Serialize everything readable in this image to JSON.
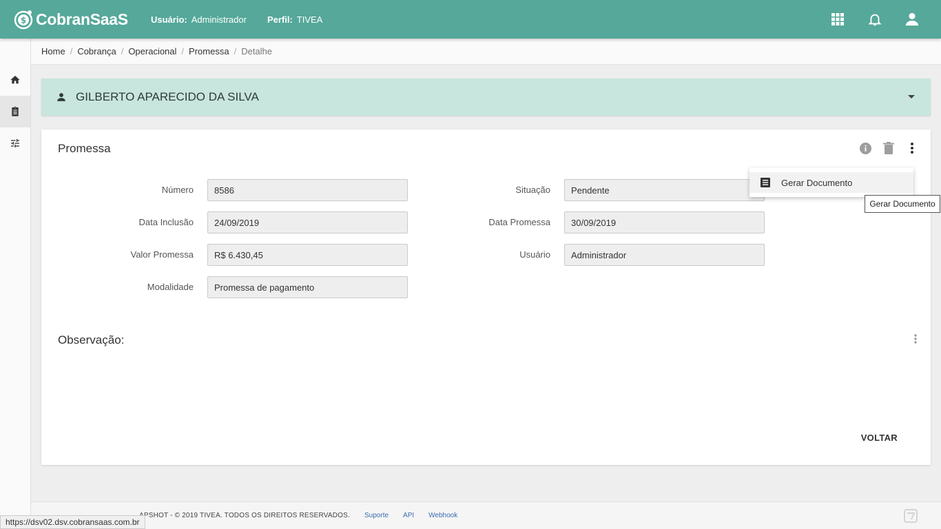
{
  "header": {
    "brand": "CobranSaaS",
    "user_label": "Usuário:",
    "user_value": "Administrador",
    "profile_label": "Perfil:",
    "profile_value": "TIVEA",
    "icons": [
      "apps-grid-icon",
      "bell-icon",
      "account-icon"
    ]
  },
  "sidebar": {
    "items": [
      {
        "icon": "home-icon",
        "active": false
      },
      {
        "icon": "clipboard-icon",
        "active": true
      },
      {
        "icon": "sliders-icon",
        "active": false
      }
    ]
  },
  "breadcrumb": {
    "items": [
      "Home",
      "Cobrança",
      "Operacional",
      "Promessa",
      "Detalhe"
    ]
  },
  "client": {
    "name": "GILBERTO APARECIDO DA SILVA"
  },
  "promessa": {
    "title": "Promessa",
    "fields": {
      "numero": {
        "label": "Número",
        "value": "8586"
      },
      "data_inclusao": {
        "label": "Data Inclusão",
        "value": "24/09/2019"
      },
      "valor_promessa": {
        "label": "Valor Promessa",
        "value": "R$ 6.430,45"
      },
      "modalidade": {
        "label": "Modalidade",
        "value": "Promessa de pagamento"
      },
      "situacao": {
        "label": "Situação",
        "value": "Pendente"
      },
      "data_promessa": {
        "label": "Data Promessa",
        "value": "30/09/2019"
      },
      "usuario": {
        "label": "Usuário",
        "value": "Administrador"
      }
    },
    "observacao_title": "Observação:",
    "voltar_label": "VOLTAR"
  },
  "menu": {
    "gerar_documento": "Gerar Documento",
    "tooltip": "Gerar Documento"
  },
  "footer": {
    "copyright": "APSHOT - © 2019 TIVEA. TODOS OS DIREITOS RESERVADOS.",
    "links": [
      "Suporte",
      "API",
      "Webhook"
    ]
  },
  "status_bar": {
    "url": "https://dsv02.dsv.cobransaas.com.br"
  },
  "colors": {
    "primary": "#55a89a",
    "client_panel": "#c8e5de",
    "link": "#3a6cb3"
  }
}
